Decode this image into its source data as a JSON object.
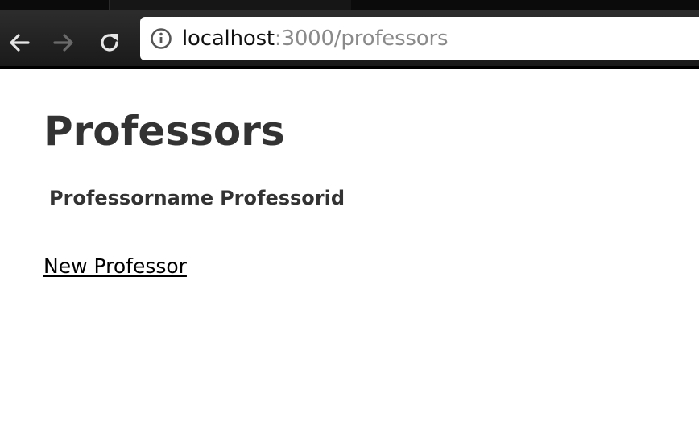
{
  "browser": {
    "url_host": "localhost",
    "url_path": ":3000/professors",
    "back_icon": "arrow-left-icon",
    "forward_icon": "arrow-right-icon",
    "reload_icon": "reload-icon",
    "site_info_icon": "info-circle-icon"
  },
  "page": {
    "title": "Professors",
    "table": {
      "columns": [
        "Professorname",
        "Professorid"
      ]
    },
    "new_link_label": "New Professor"
  }
}
